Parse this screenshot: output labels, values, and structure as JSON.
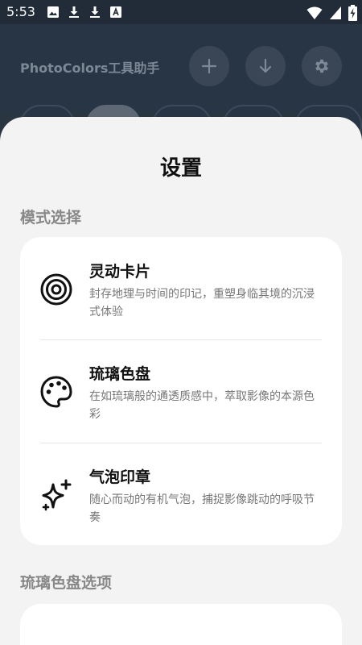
{
  "status_bar": {
    "time": "5:53",
    "left_icons": [
      "image-icon",
      "download-icon",
      "download-icon",
      "font-icon"
    ],
    "right_icons": [
      "wifi-icon",
      "signal-icon",
      "battery-charging-icon"
    ]
  },
  "app": {
    "title": "PhotoColors工具助手",
    "actions": [
      {
        "name": "add-button",
        "icon": "plus-icon"
      },
      {
        "name": "download-button",
        "icon": "download-icon"
      },
      {
        "name": "settings-button",
        "icon": "gear-icon"
      }
    ]
  },
  "sheet": {
    "title": "设置",
    "mode_section_label": "模式选择",
    "modes": [
      {
        "title": "灵动卡片",
        "description": "封存地理与时间的印记，重塑身临其境的沉浸式体验",
        "icon": "target-icon"
      },
      {
        "title": "琉璃色盘",
        "description": "在如琉璃般的通透质感中，萃取影像的本源色彩",
        "icon": "palette-icon"
      },
      {
        "title": "气泡印章",
        "description": "随心而动的有机气泡，捕捉影像跳动的呼吸节奏",
        "icon": "sparkle-icon"
      }
    ],
    "palette_section_label": "琉璃色盘选项"
  },
  "colors": {
    "status_bar_bg": "#212c38",
    "app_bg": "#283545",
    "sheet_bg": "#f3f3f3",
    "card_bg": "#ffffff",
    "section_label": "#888888"
  }
}
